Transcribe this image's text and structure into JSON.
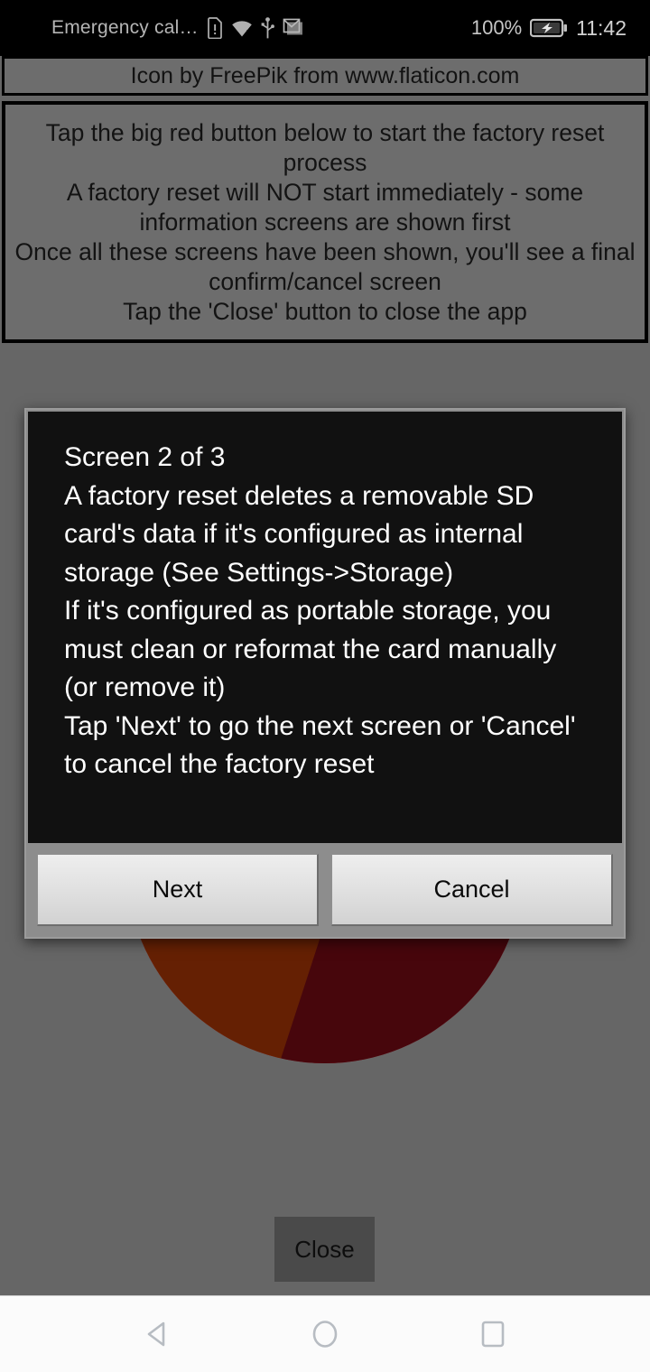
{
  "status_bar": {
    "carrier": "Emergency cal…",
    "icons": [
      "sim-alert-icon",
      "wifi-icon",
      "usb-icon",
      "gmail-icon"
    ],
    "battery_percent": "100%",
    "battery_icon": "battery-charging-icon",
    "clock": "11:42"
  },
  "banner": {
    "attribution": "Icon by FreePik from www.flaticon.com"
  },
  "instructions": {
    "lines": [
      "Tap the big red button below to start the factory reset process",
      "A factory reset will NOT start immediately - some information screens are shown first",
      "Once all these screens have been shown, you'll see a final confirm/cancel screen",
      "Tap the 'Close' button to close the app"
    ]
  },
  "red_button": {
    "name": "power-button-icon",
    "colors": {
      "primary": "#6d0a13",
      "accent": "#9c3205",
      "notch": "#1c1c1c"
    }
  },
  "dialog": {
    "lines": [
      "Screen 2 of 3",
      "A factory reset deletes a removable SD card's data if it's configured as internal storage (See Settings->Storage)",
      "If it's configured as portable storage, you must clean or reformat the card manually (or remove it)",
      "Tap 'Next' to go the next screen or 'Cancel' to cancel the factory reset"
    ],
    "next_label": "Next",
    "cancel_label": "Cancel"
  },
  "close_button": {
    "label": "Close"
  },
  "nav_bar": {
    "back": "back-icon",
    "home": "home-icon",
    "recents": "recents-icon"
  }
}
